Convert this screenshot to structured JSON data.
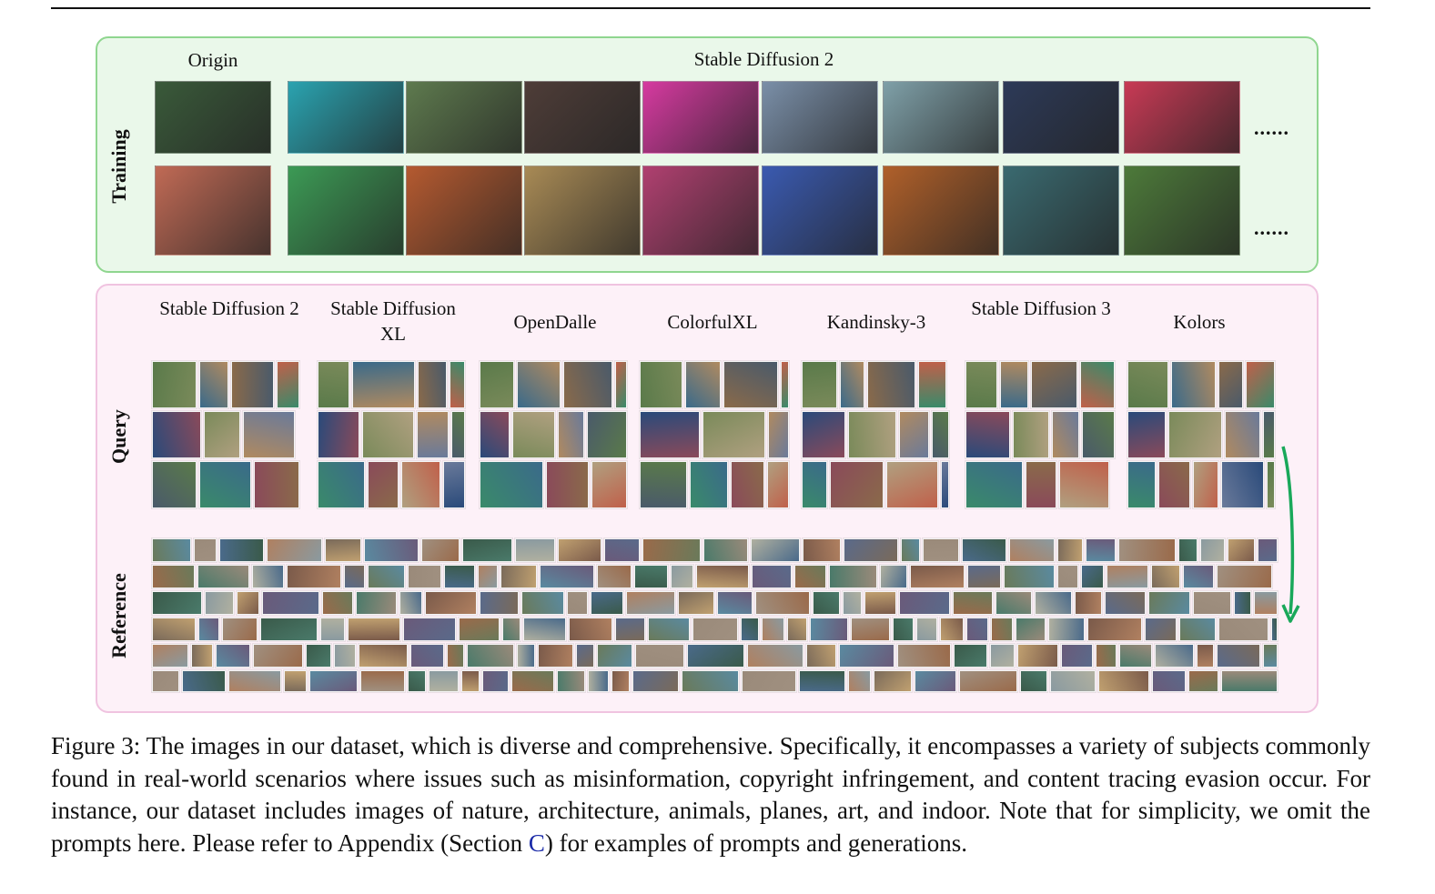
{
  "training": {
    "row_label": "Training",
    "col_labels": {
      "origin": "Origin",
      "generated": "Stable Diffusion 2"
    },
    "ellipsis": "......",
    "row1_colors": [
      "#3a5a3a",
      "#2aa3b0",
      "#5e7a4e",
      "#4e3d38",
      "#d63aa0",
      "#7a8fa8",
      "#7fa0a8",
      "#2d3a58",
      "#c83a55"
    ],
    "row2_colors": [
      "#c06a55",
      "#3c9a55",
      "#b55a30",
      "#a88a55",
      "#b04070",
      "#3a5ab0",
      "#b0602a",
      "#3a6a70",
      "#4d7a3a"
    ]
  },
  "query_panel": {
    "query_label": "Query",
    "reference_label": "Reference",
    "models": [
      {
        "name": "Stable Diffusion 2"
      },
      {
        "name": "Stable Diffusion XL"
      },
      {
        "name": "OpenDalle"
      },
      {
        "name": "ColorfulXL"
      },
      {
        "name": "Kandinsky-3"
      },
      {
        "name": "Stable Diffusion 3"
      },
      {
        "name": "Kolors"
      }
    ],
    "query_colors": [
      "#5a7a4a",
      "#3a6a8a",
      "#8a6a4a",
      "#c0604a",
      "#2a4a7a",
      "#7a8a5a",
      "#b08a60",
      "#4a5a6a",
      "#3a8a6a",
      "#8a4a5a",
      "#b0a080",
      "#6a7a9a"
    ],
    "reference_colors": [
      "#6a7a5a",
      "#9a8a7a",
      "#4a6a8a",
      "#b08060",
      "#7a6a5a",
      "#5a8aa0",
      "#a09080",
      "#3a5a4a",
      "#8a9aa0",
      "#c0a070",
      "#6a5a7a",
      "#9a6a4a",
      "#4a7a6a",
      "#b0b0a0",
      "#7a5a4a",
      "#5a6a8a"
    ]
  },
  "caption": {
    "part1": "Figure 3: The images in our dataset, which is diverse and comprehensive. Specifically, it encompasses a variety of subjects commonly found in real-world scenarios where issues such as misinformation, copyright infringement, and content tracing evasion occur. For instance, our dataset includes images of nature, architecture, animals, planes, art, and indoor. Note that for simplicity, we omit the prompts here. Please refer to Appendix (Section ",
    "link": "C",
    "part2": ") for examples of prompts and generations."
  },
  "colors": {
    "train_bg": "#eaf8ea",
    "train_border": "#8fd68f",
    "query_bg": "#fdf1f8",
    "query_border": "#f0c3e0",
    "arrow": "#19a85a",
    "link": "#1a2aa8"
  }
}
